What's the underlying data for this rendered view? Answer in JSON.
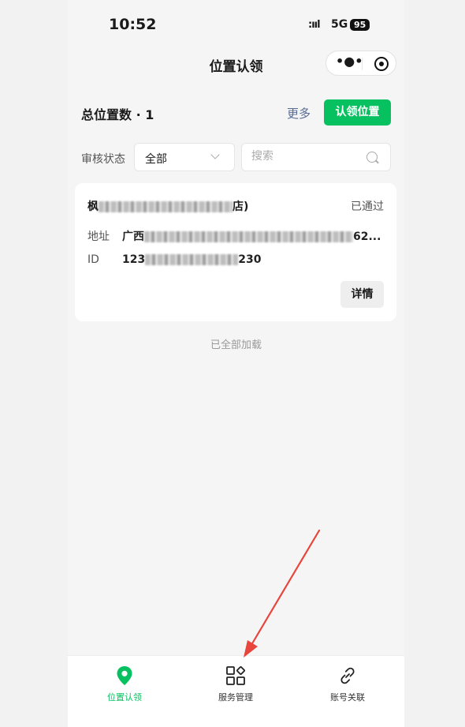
{
  "status_bar": {
    "time": "10:52",
    "signal": ":ııl",
    "network": "5G",
    "battery": "95"
  },
  "nav": {
    "title": "位置认领",
    "more_icon": "more-dots-icon",
    "close_icon": "target-close-icon"
  },
  "summary": {
    "label": "总位置数 · 1",
    "more": "更多",
    "claim_button": "认领位置"
  },
  "filter": {
    "label": "审核状态",
    "selected": "全部",
    "search_placeholder": "搜索"
  },
  "card": {
    "name_prefix": "枫",
    "name_suffix": "店)",
    "status": "已通过",
    "address_label": "地址",
    "address_prefix": "广西",
    "address_suffix": "62...",
    "id_label": "ID",
    "id_prefix": "123",
    "id_suffix": "230",
    "detail_button": "详情"
  },
  "footer_text": "已全部加载",
  "tabs": [
    {
      "label": "位置认领",
      "icon": "location-pin-icon",
      "active": true
    },
    {
      "label": "服务管理",
      "icon": "apps-grid-icon",
      "active": false
    },
    {
      "label": "账号关联",
      "icon": "link-icon",
      "active": false
    }
  ],
  "colors": {
    "primary": "#07c160",
    "link": "#576b95",
    "annotation_arrow": "#e8453c"
  }
}
